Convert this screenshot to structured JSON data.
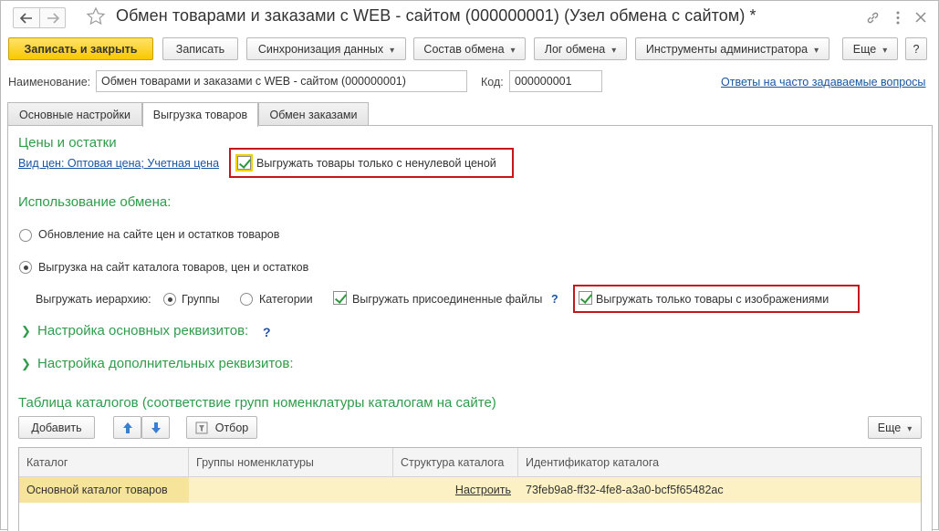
{
  "window": {
    "title": "Обмен товарами и заказами с WEB - сайтом (000000001) (Узел обмена с сайтом) *"
  },
  "toolbar": {
    "save_close": "Записать и закрыть",
    "save": "Записать",
    "sync": "Синхронизация данных",
    "exchange_content": "Состав обмена",
    "exchange_log": "Лог обмена",
    "admin_tools": "Инструменты администратора",
    "more": "Еще",
    "help": "?"
  },
  "header": {
    "name_label": "Наименование:",
    "name_value": "Обмен товарами и заказами с WEB - сайтом (000000001)",
    "code_label": "Код:",
    "code_value": "000000001",
    "faq_link": "Ответы на часто задаваемые вопросы"
  },
  "tabs": [
    {
      "label": "Основные настройки",
      "active": false
    },
    {
      "label": "Выгрузка товаров",
      "active": true
    },
    {
      "label": "Обмен заказами",
      "active": false
    }
  ],
  "prices": {
    "section_title": "Цены и остатки",
    "price_types_link": "Вид цен: Оптовая цена; Учетная цена",
    "nonzero_price_checkbox": "Выгружать товары только с ненулевой ценой",
    "nonzero_price_checked": true
  },
  "usage": {
    "section_title": "Использование обмена:",
    "option_prices_stock": "Обновление на сайте цен и остатков товаров",
    "option_catalog": "Выгрузка на сайт каталога товаров, цен и остатков",
    "selected_option": "option_catalog",
    "hierarchy_label": "Выгружать иерархию:",
    "hierarchy_groups": "Группы",
    "hierarchy_categories": "Категории",
    "hierarchy_selected": "Группы",
    "attached_files_checkbox": "Выгружать присоединенные файлы",
    "attached_files_checked": true,
    "attached_files_help": "?",
    "images_only_checkbox": "Выгружать только товары с изображениями",
    "images_only_checked": true
  },
  "groups": {
    "main_attrs": "Настройка основных реквизитов:",
    "main_attrs_help": "?",
    "extra_attrs": "Настройка дополнительных реквизитов:"
  },
  "catalogs": {
    "section_title": "Таблица каталогов (соответствие групп номенклатуры каталогам на сайте)",
    "add_button": "Добавить",
    "pick_button": "Отбор",
    "more_button": "Еще",
    "columns": [
      "Каталог",
      "Группы номенклатуры",
      "Структура каталога",
      "Идентификатор каталога"
    ],
    "rows": [
      {
        "catalog": "Основной каталог товаров",
        "groups": "",
        "structure": "Настроить",
        "id": "73feb9a8-ff32-4fe8-a3a0-bcf5f65482ac"
      }
    ]
  },
  "colors": {
    "accent_green": "#2e9c4a",
    "primary_button": "#f8c800",
    "highlight_box": "#c4161c",
    "link": "#1a55a3",
    "selected_row": "#fbf1c4"
  }
}
